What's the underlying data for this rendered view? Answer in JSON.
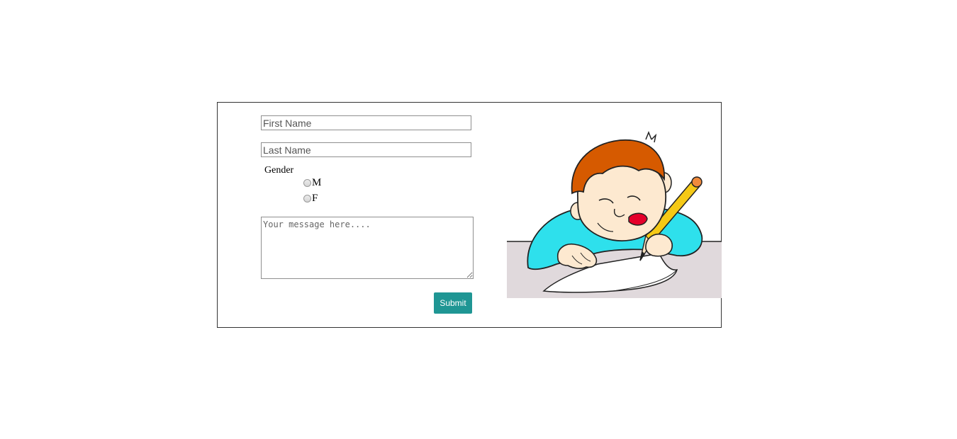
{
  "form": {
    "first_name": {
      "value": "",
      "placeholder": "First Name"
    },
    "last_name": {
      "value": "",
      "placeholder": "Last Name"
    },
    "gender": {
      "label": "Gender",
      "options": [
        {
          "label": "M",
          "checked": false
        },
        {
          "label": "F",
          "checked": false
        }
      ]
    },
    "message": {
      "value": "",
      "placeholder": "Your message here...."
    },
    "submit_label": "Submit"
  },
  "illustration": {
    "icon": "boy-writing-illustration"
  },
  "colors": {
    "submit_button": "#1f9694",
    "border": "#333333",
    "desk": "#e0d9dc",
    "shirt": "#2ee0ec",
    "hair": "#d65a00",
    "pencil": "#f5c916"
  }
}
